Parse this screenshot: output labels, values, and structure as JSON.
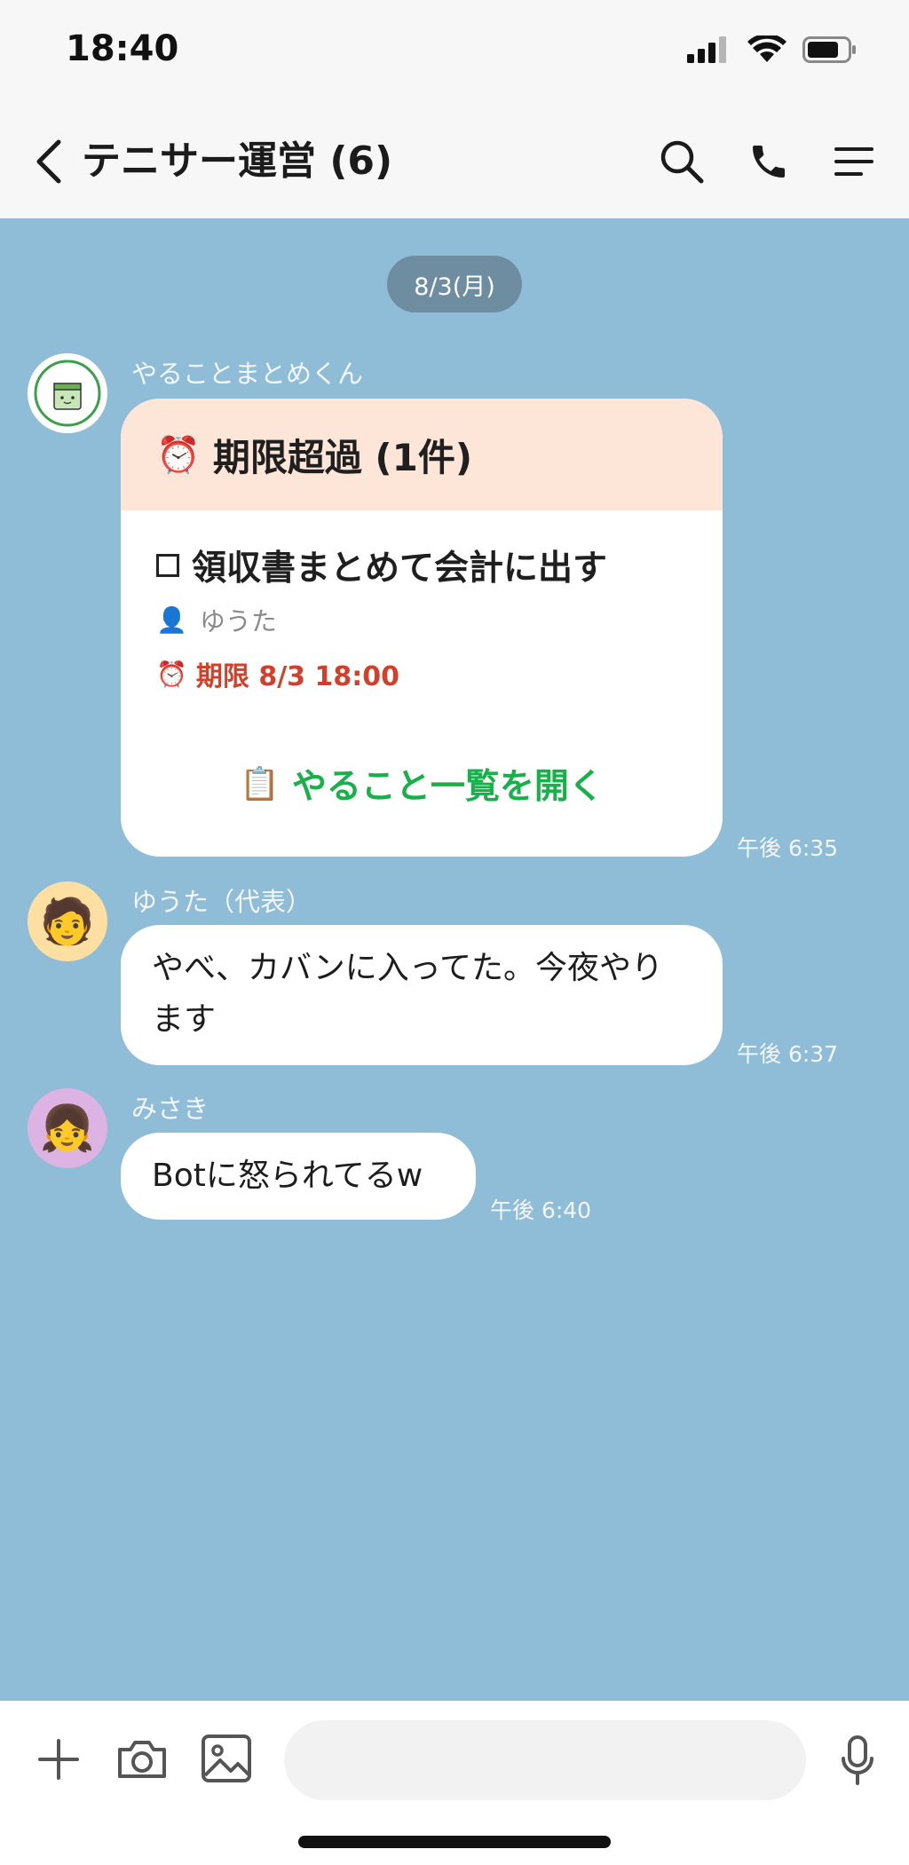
{
  "status_bar": {
    "time": "18:40"
  },
  "header": {
    "title": "テニサー運営 (6)"
  },
  "date_divider": "8/3(月)",
  "messages": [
    {
      "sender": "やることまとめくん",
      "card": {
        "header_emoji": "⏰",
        "title": "期限超過 (1件)",
        "task": "領収書まとめて会計に出す",
        "assignee_emoji": "👤",
        "assignee": "ゆうた",
        "due_emoji": "⏰",
        "due": "期限 8/3 18:00",
        "action_emoji": "📋",
        "action": "やること一覧を開く"
      },
      "time": "午後 6:35"
    },
    {
      "sender": "ゆうた（代表）",
      "avatar_emoji": "🧑",
      "text": "やべ、カバンに入ってた。今夜やります",
      "time": "午後 6:37"
    },
    {
      "sender": "みさき",
      "avatar_emoji": "👧",
      "text": "Botに怒られてるw",
      "time": "午後 6:40"
    }
  ],
  "bot_avatar_label": "やることまとめくん",
  "colors": {
    "chat_background": "#8fbcd6",
    "card_header": "#fde6d8",
    "overdue_red": "#d2402b",
    "action_green": "#17b14a"
  },
  "input": {
    "placeholder": ""
  }
}
